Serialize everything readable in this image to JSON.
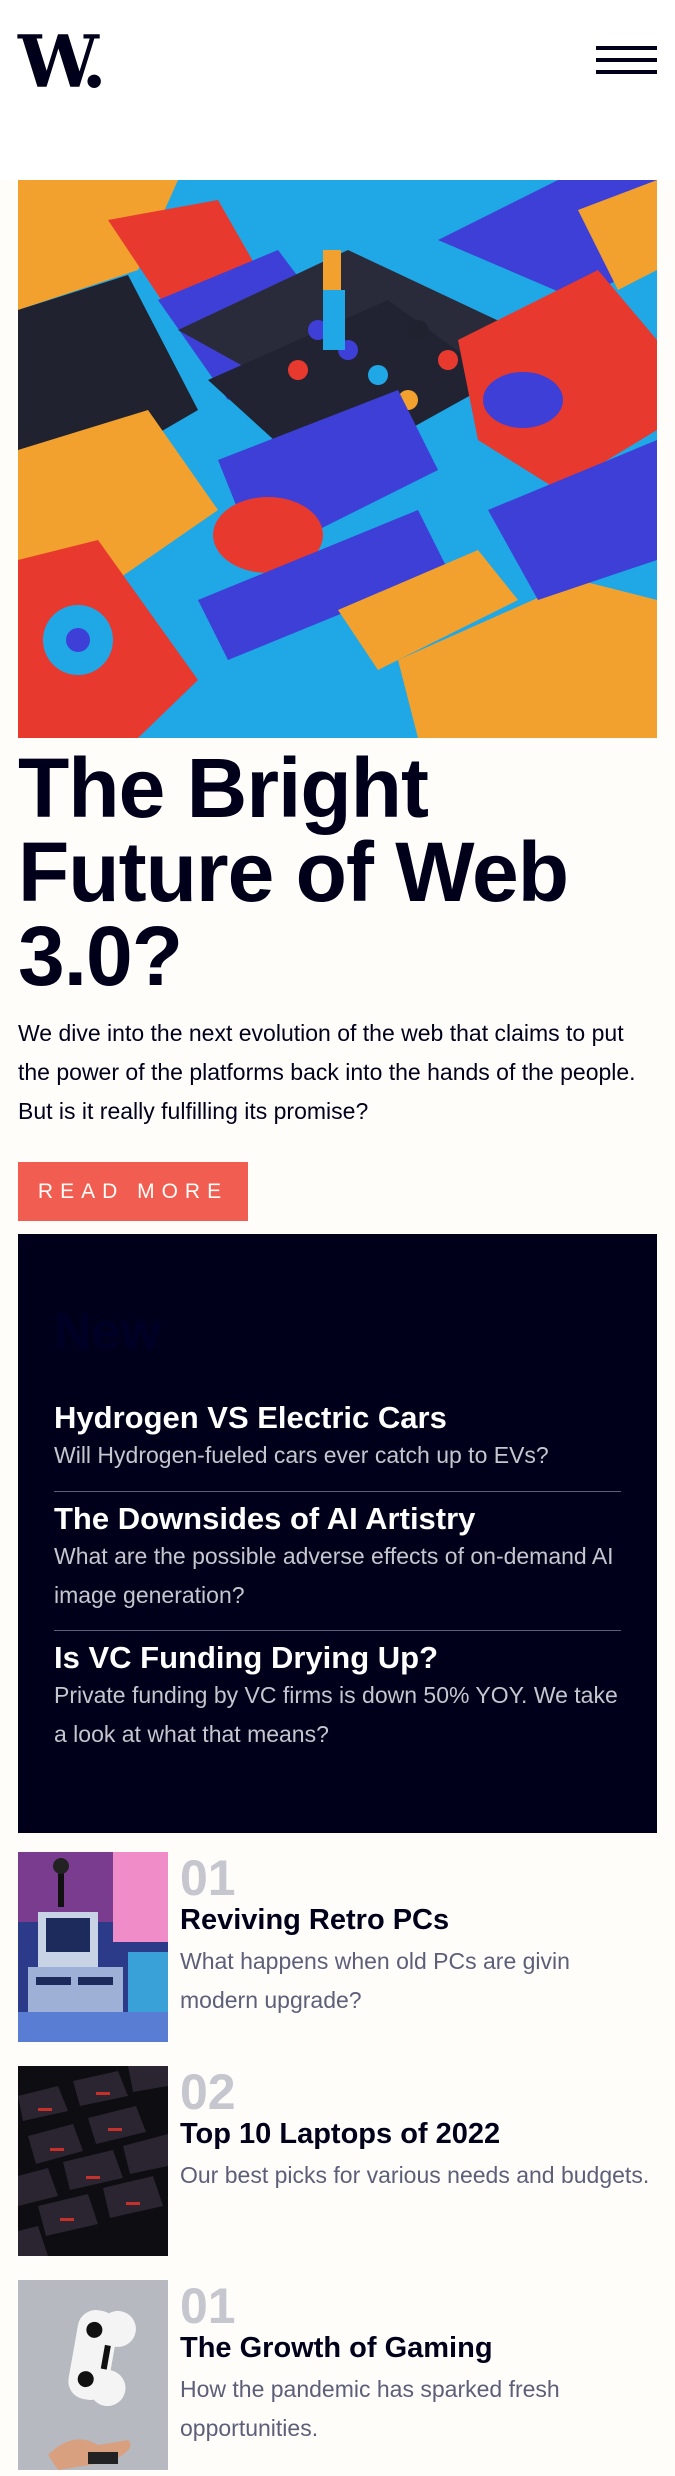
{
  "brand": {
    "logo": "W."
  },
  "header": {
    "menu_icon": "hamburger-menu-icon"
  },
  "hero": {
    "image_icon": "abstract-3d-shapes-illustration",
    "title": "The Bright Future of Web 3.0?",
    "text": "We dive into the next evolution of the web that claims to put the power of the platforms back into the hands of the people. But is it really fulfilling its promise?",
    "button_label": "READ MORE"
  },
  "new_panel": {
    "heading": "New",
    "items": [
      {
        "title": "Hydrogen VS Electric Cars",
        "text": "Will Hydrogen-fueled cars ever catch up to EVs?"
      },
      {
        "title": "The Downsides of AI Artistry",
        "text": "What are the possible adverse effects of on-demand AI image generation?"
      },
      {
        "title": "Is VC Funding Drying Up?",
        "text": "Private funding by VC firms is down 50% YOY. We take a look at what that means?"
      }
    ]
  },
  "articles": [
    {
      "number": "01",
      "title": "Reviving Retro PCs",
      "text": "What happens when old PCs are givin modern upgrade?",
      "thumb_icon": "retro-pc-image"
    },
    {
      "number": "02",
      "title": "Top 10 Laptops of 2022",
      "text": "Our best picks for various needs and budgets.",
      "thumb_icon": "laptop-keyboard-image"
    },
    {
      "number": "01",
      "title": "The Growth of Gaming",
      "text": "How the pandemic has sparked fresh opportunities.",
      "thumb_icon": "game-controller-image"
    }
  ],
  "colors": {
    "navy": "#00001a",
    "accent": "#f15d51",
    "muted": "#5d5f79",
    "light": "#c5c6ce",
    "background": "#fffdfa"
  }
}
